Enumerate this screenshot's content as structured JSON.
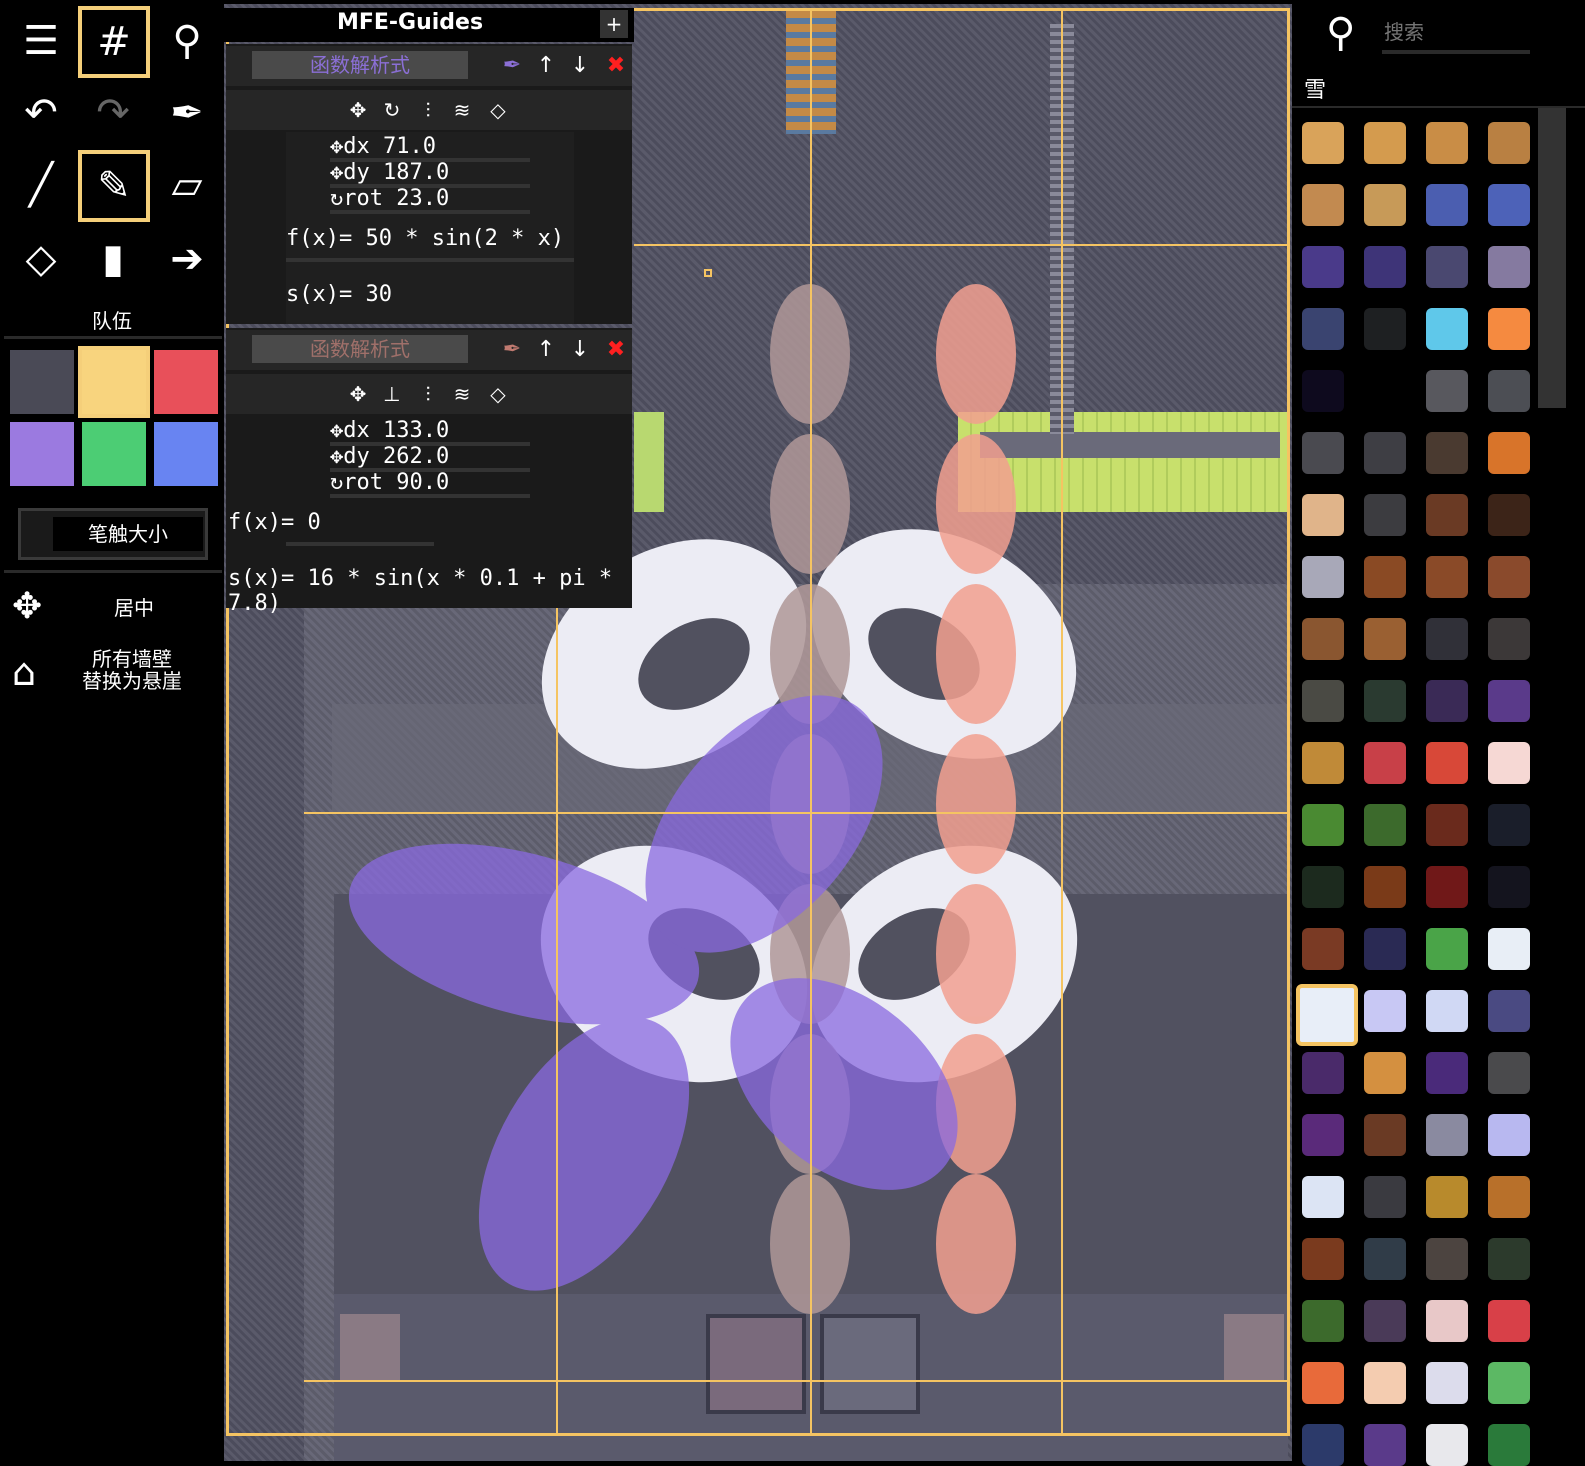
{
  "left": {
    "team_label": "队伍",
    "brush_size_label": "笔触大小",
    "center_label": "居中",
    "replace_walls_label_1": "所有墙壁",
    "replace_walls_label_2": "替换为悬崖",
    "swatches": [
      "#4a4a56",
      "#f8d47e",
      "#e8505a",
      "#9b7ae0",
      "#4ccd74",
      "#6884f2"
    ]
  },
  "guides": {
    "title": "MFE-Guides",
    "add_label": "+",
    "guide1": {
      "name": "函数解析式",
      "dx_label": "dx",
      "dx": "71.0",
      "dy_label": "dy",
      "dy": "187.0",
      "rot_label": "rot",
      "rot": "23.0",
      "fx": "f(x)= 50 * sin(2 * x)",
      "sx": "s(x)= 30"
    },
    "guide2": {
      "name": "函数解析式",
      "dx_label": "dx",
      "dx": "133.0",
      "dy_label": "dy",
      "dy": "262.0",
      "rot_label": "rot",
      "rot": "90.0",
      "fx": "f(x)= 0",
      "sx": "s(x)= 16 * sin(x * 0.1 + pi * 7.8)"
    }
  },
  "right": {
    "search_placeholder": "搜索",
    "category_label": "雪",
    "tiles": [
      "#d9a35a",
      "#d49b4e",
      "#c98d46",
      "#b98042",
      "#c28a50",
      "#c79a58",
      "#4b5eb0",
      "#4d62b8",
      "#4a3a8a",
      "#3e3478",
      "#4a4870",
      "#857aa0",
      "#3a4470",
      "#1e2022",
      "#5fc8ea",
      "#f58a40",
      "#0e0a1e",
      "#000000",
      "#58585e",
      "#4c4e54",
      "#4a4a50",
      "#3e3e44",
      "#4a3a30",
      "#d8742a",
      "#e0b48a",
      "#3c3c40",
      "#6a3a24",
      "#3c2418",
      "#a8a8b8",
      "#8a4a24",
      "#8a4a28",
      "#8a4a2c",
      "#8a5630",
      "#9a6032",
      "#303038",
      "#3c3838",
      "#4a4a44",
      "#2a3a30",
      "#3a2a56",
      "#5a3a8a",
      "#c08a38",
      "#c84048",
      "#d84838",
      "#f6d8d4",
      "#4a8a32",
      "#3c6a2c",
      "#6a2a1c",
      "#1a1e2a",
      "#1c2a1e",
      "#7a3a18",
      "#701818",
      "#14141e",
      "#7a3a24",
      "#2a2a54",
      "#4aa448",
      "#e8eef6",
      "#e8eef8",
      "#c8c8f4",
      "#d0d8f4",
      "#4a4a82",
      "#4a2a6a",
      "#d49040",
      "#4a2a7a",
      "#4a4a4c",
      "#5a2a7a",
      "#6a3a24",
      "#8a8aa0",
      "#b8b8f0",
      "#dce4f4",
      "#3a3a40",
      "#b88a2c",
      "#b8702a",
      "#7a3a1e",
      "#303c48",
      "#4c4440",
      "#2c3a2c",
      "#3c6a2c",
      "#4a3a58",
      "#e8c8c8",
      "#d84048",
      "#e86a3a",
      "#f4ccb0",
      "#dcdcec",
      "#5cb864",
      "#2c3a6a",
      "#5a3a8a",
      "#e8e8ec",
      "#2a7a3a"
    ]
  }
}
